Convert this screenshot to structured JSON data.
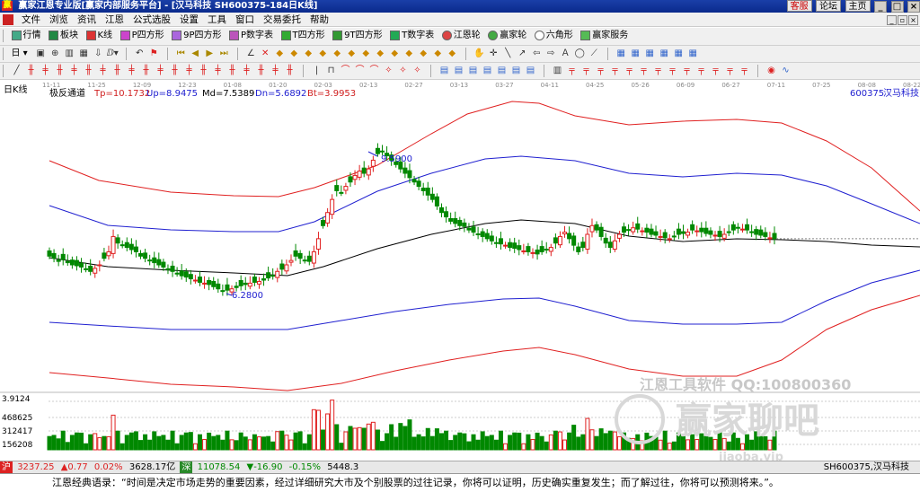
{
  "window": {
    "title": "赢家江恩专业版[赢家内部服务平台] - [汉马科技  SH600375-184日K线]",
    "links": [
      "客服",
      "论坛",
      "主页"
    ]
  },
  "menu": [
    "文件",
    "浏览",
    "资讯",
    "江恩",
    "公式选股",
    "设置",
    "工具",
    "窗口",
    "交易委托",
    "帮助"
  ],
  "toolbar1": [
    {
      "label": "行情",
      "icon": "quote-icon"
    },
    {
      "label": "板块",
      "icon": "sector-icon"
    },
    {
      "label": "K线",
      "icon": "kline-icon"
    },
    {
      "label": "P四方形",
      "icon": "p-square-icon"
    },
    {
      "label": "9P四方形",
      "icon": "9p-square-icon"
    },
    {
      "label": "P数字表",
      "icon": "p-number-icon"
    },
    {
      "label": "T四方形",
      "icon": "t-square-icon"
    },
    {
      "label": "9T四方形",
      "icon": "9t-square-icon"
    },
    {
      "label": "T数字表",
      "icon": "t-number-icon"
    },
    {
      "label": "江恩轮",
      "icon": "gann-wheel-icon"
    },
    {
      "label": "赢家轮",
      "icon": "winner-wheel-icon"
    },
    {
      "label": "六角形",
      "icon": "hexagon-icon"
    },
    {
      "label": "赢家服务",
      "icon": "service-icon"
    }
  ],
  "toolbar2_first": "日",
  "chart_header": {
    "period": "日K线",
    "indicator": "极反通道",
    "tp": "Tp=10.1732",
    "up": "Up=8.9475",
    "md": "Md=7.5389",
    "dn": "Dn=5.6892",
    "bt": "Bt=3.9953",
    "code": "600375",
    "name": "汉马科技"
  },
  "date_labels": [
    "11-11",
    "11-25",
    "12-09",
    "12-23",
    "01-08",
    "01-20",
    "02-03",
    "02-13",
    "02-27",
    "03-13",
    "03-27",
    "04-11",
    "04-25",
    "05-26",
    "06-09",
    "06-27",
    "07-11",
    "07-25",
    "08-08",
    "08-22"
  ],
  "volume_axis": [
    "3.9124",
    "468625",
    "312417",
    "156208"
  ],
  "annotations": {
    "high": "9.5900",
    "low": "6.2800"
  },
  "watermark": {
    "line1": "江恩工具软件   QQ:100800360",
    "line2": "赢家聊吧",
    "line3": "iiaoba.vip"
  },
  "colors": {
    "up": "#e02020",
    "down": "#008800",
    "band_red": "#e02020",
    "band_blue": "#2020d0",
    "mid": "#000000"
  },
  "status": {
    "sh_value": "3237.25",
    "sh_change": "▲0.77",
    "sh_pct": "0.02%",
    "sh_amount": "3628.17亿",
    "sz_value": "11078.54",
    "sz_change": "▼-16.90",
    "sz_pct": "-0.15%",
    "sz_amount": "5448.3",
    "stock": "SH600375,汉马科技"
  },
  "quote": "江恩经典语录：“时间是决定市场走势的重要因素，经过详细研究大市及个别股票的过往记录，你将可以证明，历史确实重复发生；而了解过往，你将可以预测将来。”。",
  "chart_data": {
    "type": "candlestick",
    "y_range_note": "price axis unlabeled",
    "high": 9.59,
    "low": 6.28,
    "channel_values": {
      "tp": 10.1732,
      "up": 8.9475,
      "md": 7.5389,
      "dn": 5.6892,
      "bt": 3.9953
    },
    "x_labels": [
      "11-11",
      "11-25",
      "12-09",
      "12-23",
      "01-08",
      "01-20",
      "02-03",
      "02-13",
      "02-27",
      "03-13",
      "03-27",
      "04-11",
      "04-25",
      "05-26",
      "06-09",
      "06-27",
      "07-11",
      "07-25",
      "08-08",
      "08-22"
    ],
    "close": [
      7.1,
      7.05,
      6.98,
      7.02,
      6.95,
      6.9,
      6.88,
      6.85,
      6.8,
      6.75,
      6.82,
      6.9,
      7.05,
      7.2,
      7.55,
      7.4,
      7.35,
      7.3,
      7.25,
      7.2,
      7.1,
      7.05,
      7.0,
      6.95,
      6.9,
      6.85,
      6.8,
      6.75,
      6.7,
      6.65,
      6.62,
      6.58,
      6.55,
      6.5,
      6.48,
      6.45,
      6.4,
      6.35,
      6.3,
      6.32,
      6.35,
      6.38,
      6.42,
      6.45,
      6.48,
      6.5,
      6.52,
      6.55,
      6.6,
      6.65,
      6.75,
      6.8,
      6.9,
      7.0,
      7.1,
      7.05,
      7.0,
      6.98,
      7.2,
      7.5,
      7.8,
      8.1,
      8.4,
      8.6,
      8.55,
      8.7,
      8.8,
      8.95,
      9.05,
      9.0,
      9.1,
      9.3,
      9.45,
      9.5,
      9.4,
      9.3,
      9.2,
      9.1,
      9.0,
      8.9,
      8.8,
      8.7,
      8.6,
      8.5,
      8.4,
      8.25,
      8.1,
      8.0,
      7.9,
      7.85,
      7.8,
      7.78,
      7.7,
      7.65,
      7.6,
      7.55,
      7.5,
      7.45,
      7.4,
      7.38,
      7.35,
      7.3,
      7.28,
      7.25,
      7.22,
      7.2,
      7.18,
      7.15,
      7.2,
      7.25,
      7.3,
      7.4,
      7.55,
      7.65,
      7.5,
      7.35,
      7.2,
      7.3,
      7.6,
      7.8,
      7.7,
      7.55,
      7.4,
      7.3,
      7.45,
      7.6,
      7.65,
      7.7,
      7.75,
      7.72,
      7.68,
      7.65,
      7.6,
      7.58,
      7.55,
      7.52,
      7.5,
      7.55,
      7.6,
      7.62,
      7.65,
      7.7,
      7.68,
      7.66,
      7.62,
      7.6,
      7.58,
      7.55,
      7.6,
      7.65,
      7.7,
      7.75,
      7.72,
      7.7,
      7.65,
      7.6,
      7.58,
      7.55,
      7.52,
      7.5
    ],
    "volume_unit": "lots"
  }
}
